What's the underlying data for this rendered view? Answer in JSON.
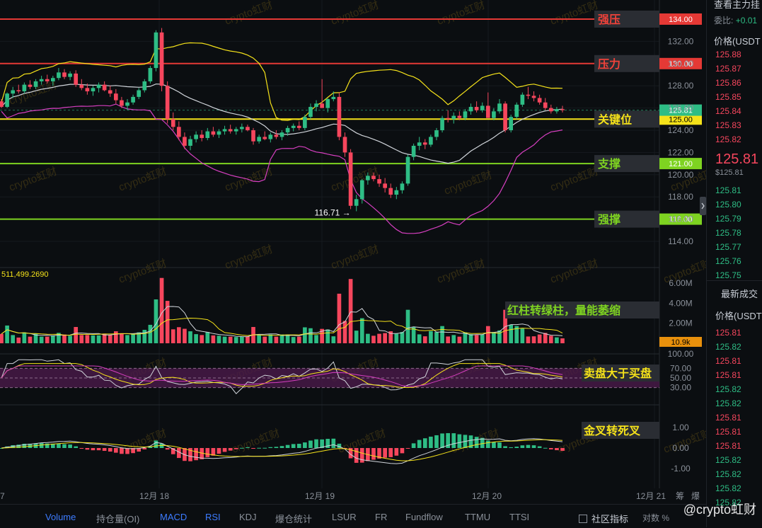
{
  "header": {
    "title_fragment": "查看主力挂",
    "ratio_label": "委比:",
    "ratio_value": "+0.01"
  },
  "watermark": "crypto虹财",
  "price_panel": {
    "header_price": "价格(USDT",
    "top_prices": [
      "125.88",
      "125.87",
      "125.86",
      "125.85",
      "125.84",
      "125.83",
      "125.82"
    ],
    "last_price": "125.81",
    "last_price_sub": "$125.81",
    "bottom_prices": [
      "125.81",
      "125.80",
      "125.79",
      "125.78",
      "125.77",
      "125.76",
      "125.75"
    ],
    "trades_title": "最新成交",
    "trades_header": "价格(USDT",
    "trades": [
      {
        "p": "125.81",
        "c": "#f6465d"
      },
      {
        "p": "125.82",
        "c": "#2ebd85"
      },
      {
        "p": "125.81",
        "c": "#f6465d"
      },
      {
        "p": "125.81",
        "c": "#f6465d"
      },
      {
        "p": "125.82",
        "c": "#2ebd85"
      },
      {
        "p": "125.82",
        "c": "#2ebd85"
      },
      {
        "p": "125.81",
        "c": "#f6465d"
      },
      {
        "p": "125.81",
        "c": "#f6465d"
      },
      {
        "p": "125.81",
        "c": "#f6465d"
      },
      {
        "p": "125.82",
        "c": "#2ebd85"
      },
      {
        "p": "125.82",
        "c": "#2ebd85"
      },
      {
        "p": "125.82",
        "c": "#2ebd85"
      },
      {
        "p": "125.82",
        "c": "#2ebd85"
      }
    ]
  },
  "levels": [
    {
      "label": "强压",
      "price": 134.0,
      "tag": "134.00",
      "color": "#e53935",
      "label_color": "#f0423a"
    },
    {
      "label": "压力",
      "price": 130.0,
      "tag": "130.00",
      "color": "#e53935",
      "label_color": "#f0423a"
    },
    {
      "label": "关键位",
      "price": 125.0,
      "tag": "125.00",
      "color": "#f5e21a",
      "label_color": "#f5e21a"
    },
    {
      "label": "支撑",
      "price": 121.0,
      "tag": "121.00",
      "color": "#7ed321",
      "label_color": "#7ed321"
    },
    {
      "label": "强撑",
      "price": 116.0,
      "tag": "116.00",
      "color": "#7ed321",
      "label_color": "#7ed321"
    }
  ],
  "current_price_tag": "125.81",
  "current_price": 125.81,
  "low_annotation": "116.71 →",
  "low_price": 116.71,
  "price_axis_ticks": [
    "132.00",
    "130.00",
    "128.00",
    "126.00",
    "124.00",
    "122.00",
    "120.00",
    "118.00",
    "116.00",
    "114.00"
  ],
  "volume_header": "511,499.2690",
  "volume_axis": [
    "6.00M",
    "4.00M",
    "2.00M"
  ],
  "volume_tag": "10.9k",
  "rsi_axis": [
    "100.00",
    "70.00",
    "50.00",
    "30.00"
  ],
  "macd_axis": [
    "1.00",
    "0.00",
    "-1.00"
  ],
  "annotations": {
    "volume": "红柱转绿柱，量能萎缩",
    "rsi": "卖盘大于买盘",
    "macd": "金叉转死叉"
  },
  "x_labels": [
    "7",
    "12月 18",
    "12月 19",
    "12月 20",
    "12月 21"
  ],
  "axis_right_labels": [
    "筹",
    "爆"
  ],
  "tabs": [
    {
      "label": "Volume",
      "active": true
    },
    {
      "label": "持仓量(OI)",
      "active": false
    },
    {
      "label": "MACD",
      "active": true
    },
    {
      "label": "RSI",
      "active": true
    },
    {
      "label": "KDJ",
      "active": false
    },
    {
      "label": "爆仓统计",
      "active": false
    },
    {
      "label": "LSUR",
      "active": false
    },
    {
      "label": "FR",
      "active": false
    },
    {
      "label": "Fundflow",
      "active": false
    },
    {
      "label": "TTMU",
      "active": false
    },
    {
      "label": "TTSI",
      "active": false
    }
  ],
  "community_label": "社区指标",
  "footer_fragment": "对数 %",
  "footer_brand": "@crypto虹财",
  "colors": {
    "up": "#2ebd85",
    "down": "#f6465d",
    "bg": "#0b0e11"
  },
  "chart_data": {
    "type": "candlestick",
    "y_range": [
      113,
      134.5
    ],
    "candles": [
      [
        126.6,
        126.8,
        126.0,
        126.1
      ],
      [
        126.1,
        127.4,
        126.0,
        127.3
      ],
      [
        127.3,
        127.9,
        126.9,
        127.6
      ],
      [
        127.6,
        128.1,
        127.3,
        127.5
      ],
      [
        127.5,
        128.3,
        127.3,
        128.1
      ],
      [
        128.1,
        128.5,
        127.7,
        127.9
      ],
      [
        127.9,
        128.6,
        127.7,
        128.4
      ],
      [
        128.4,
        128.9,
        128.1,
        128.6
      ],
      [
        128.6,
        129.0,
        128.2,
        128.4
      ],
      [
        128.4,
        128.9,
        128.0,
        128.7
      ],
      [
        128.7,
        129.6,
        128.5,
        129.2
      ],
      [
        129.2,
        129.5,
        128.6,
        128.8
      ],
      [
        128.8,
        129.3,
        128.5,
        129.1
      ],
      [
        129.1,
        129.4,
        127.9,
        128.1
      ],
      [
        128.1,
        128.6,
        127.6,
        127.8
      ],
      [
        127.8,
        128.2,
        127.2,
        127.5
      ],
      [
        127.5,
        128.0,
        127.1,
        127.8
      ],
      [
        127.8,
        128.3,
        127.4,
        128.1
      ],
      [
        128.1,
        128.4,
        127.5,
        127.6
      ],
      [
        127.6,
        128.0,
        127.0,
        127.3
      ],
      [
        127.3,
        127.7,
        126.4,
        126.7
      ],
      [
        126.7,
        127.0,
        126.0,
        126.2
      ],
      [
        126.2,
        126.8,
        125.8,
        126.5
      ],
      [
        126.5,
        127.2,
        126.3,
        127.0
      ],
      [
        127.0,
        127.8,
        126.8,
        127.6
      ],
      [
        127.6,
        128.6,
        127.4,
        128.4
      ],
      [
        128.4,
        129.8,
        128.2,
        129.6
      ],
      [
        129.6,
        133.0,
        129.3,
        132.8
      ],
      [
        132.8,
        133.2,
        127.5,
        128.0
      ],
      [
        128.0,
        128.4,
        124.6,
        125.0
      ],
      [
        125.0,
        125.6,
        124.0,
        124.3
      ],
      [
        124.3,
        124.8,
        123.1,
        123.4
      ],
      [
        123.4,
        123.8,
        122.3,
        122.6
      ],
      [
        122.6,
        123.5,
        122.2,
        123.2
      ],
      [
        123.2,
        123.9,
        122.9,
        123.6
      ],
      [
        123.6,
        124.0,
        123.0,
        123.3
      ],
      [
        123.3,
        124.2,
        123.1,
        123.9
      ],
      [
        123.9,
        124.3,
        123.4,
        123.6
      ],
      [
        123.6,
        124.1,
        123.3,
        123.9
      ],
      [
        123.9,
        124.4,
        123.6,
        124.1
      ],
      [
        124.1,
        124.5,
        123.7,
        123.9
      ],
      [
        123.9,
        124.3,
        123.6,
        124.1
      ],
      [
        124.1,
        124.6,
        123.8,
        124.3
      ],
      [
        124.3,
        124.5,
        123.9,
        124.0
      ],
      [
        124.0,
        124.2,
        122.7,
        123.0
      ],
      [
        123.0,
        123.6,
        122.8,
        123.4
      ],
      [
        123.4,
        123.9,
        123.1,
        123.2
      ],
      [
        123.2,
        123.8,
        122.9,
        123.6
      ],
      [
        123.6,
        124.0,
        123.2,
        123.4
      ],
      [
        123.4,
        124.0,
        123.1,
        123.8
      ],
      [
        123.8,
        124.4,
        123.5,
        124.2
      ],
      [
        124.2,
        124.6,
        123.9,
        124.4
      ],
      [
        124.4,
        124.8,
        124.0,
        124.2
      ],
      [
        124.2,
        125.4,
        124.0,
        125.2
      ],
      [
        125.2,
        126.4,
        125.0,
        126.1
      ],
      [
        126.1,
        126.7,
        125.7,
        126.4
      ],
      [
        126.4,
        128.6,
        126.1,
        126.0
      ],
      [
        126.0,
        126.9,
        125.6,
        126.8
      ],
      [
        126.8,
        127.5,
        126.6,
        127.0
      ],
      [
        127.0,
        127.4,
        123.1,
        123.4
      ],
      [
        123.4,
        123.8,
        121.6,
        122.0
      ],
      [
        122.0,
        122.3,
        116.9,
        117.2
      ],
      [
        117.2,
        118.2,
        116.71,
        117.8
      ],
      [
        117.8,
        119.6,
        117.4,
        119.5
      ],
      [
        119.5,
        120.2,
        119.1,
        119.9
      ],
      [
        119.9,
        120.2,
        119.4,
        119.6
      ],
      [
        119.6,
        120.0,
        118.9,
        119.2
      ],
      [
        119.2,
        119.7,
        118.4,
        118.8
      ],
      [
        118.8,
        119.2,
        117.9,
        118.2
      ],
      [
        118.2,
        118.9,
        117.8,
        118.6
      ],
      [
        118.6,
        119.4,
        118.3,
        119.2
      ],
      [
        119.2,
        121.8,
        119.0,
        121.6
      ],
      [
        121.6,
        122.8,
        121.3,
        122.6
      ],
      [
        122.6,
        123.4,
        122.2,
        122.9
      ],
      [
        122.9,
        123.2,
        122.3,
        122.7
      ],
      [
        122.7,
        123.6,
        122.5,
        123.4
      ],
      [
        123.4,
        124.2,
        123.1,
        124.0
      ],
      [
        124.0,
        125.3,
        123.8,
        125.1
      ],
      [
        125.1,
        125.8,
        124.7,
        125.0
      ],
      [
        125.0,
        125.6,
        124.6,
        125.3
      ],
      [
        125.3,
        125.7,
        124.9,
        125.1
      ],
      [
        125.1,
        125.9,
        124.9,
        125.7
      ],
      [
        125.7,
        126.4,
        125.4,
        126.1
      ],
      [
        126.1,
        126.6,
        125.6,
        125.8
      ],
      [
        125.8,
        126.5,
        125.6,
        126.2
      ],
      [
        126.2,
        127.4,
        125.9,
        125.1
      ],
      [
        125.1,
        126.0,
        124.9,
        125.7
      ],
      [
        125.7,
        126.8,
        125.5,
        126.4
      ],
      [
        126.4,
        126.6,
        123.8,
        124.0
      ],
      [
        124.0,
        125.4,
        123.8,
        125.2
      ],
      [
        125.2,
        126.5,
        125.0,
        126.3
      ],
      [
        126.3,
        127.4,
        126.1,
        127.2
      ],
      [
        127.2,
        127.9,
        126.8,
        127.1
      ],
      [
        127.1,
        127.5,
        126.6,
        126.9
      ],
      [
        126.9,
        127.2,
        126.3,
        126.5
      ],
      [
        126.5,
        126.9,
        125.8,
        126.0
      ],
      [
        126.0,
        126.3,
        125.5,
        125.7
      ],
      [
        125.7,
        126.1,
        125.5,
        125.9
      ],
      [
        125.9,
        126.2,
        125.6,
        125.81
      ]
    ],
    "volume_scale_max": 6.0,
    "rsi_band": [
      30,
      70
    ],
    "macd_range": [
      -1.5,
      1.5
    ]
  }
}
